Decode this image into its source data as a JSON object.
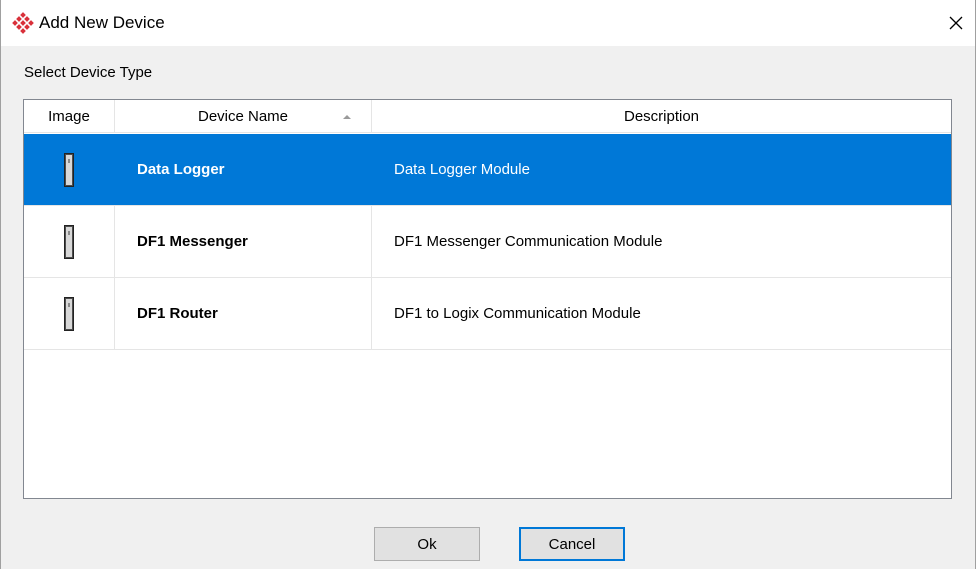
{
  "window": {
    "title": "Add New Device",
    "close_symbol": "✕",
    "accent": "#0078d7",
    "logo_color": "#d9303a"
  },
  "section_label": "Select Device Type",
  "table": {
    "columns": [
      "Image",
      "Device Name",
      "Description"
    ],
    "sort_column": "Device Name",
    "rows": [
      {
        "icon": "device-module-icon",
        "name": "Data Logger",
        "description": "Data Logger Module",
        "selected": true
      },
      {
        "icon": "device-module-icon",
        "name": "DF1 Messenger",
        "description": "DF1 Messenger Communication Module",
        "selected": false
      },
      {
        "icon": "device-module-icon",
        "name": "DF1 Router",
        "description": "DF1 to Logix Communication Module",
        "selected": false
      }
    ]
  },
  "buttons": {
    "ok_label": "Ok",
    "cancel_label": "Cancel"
  }
}
